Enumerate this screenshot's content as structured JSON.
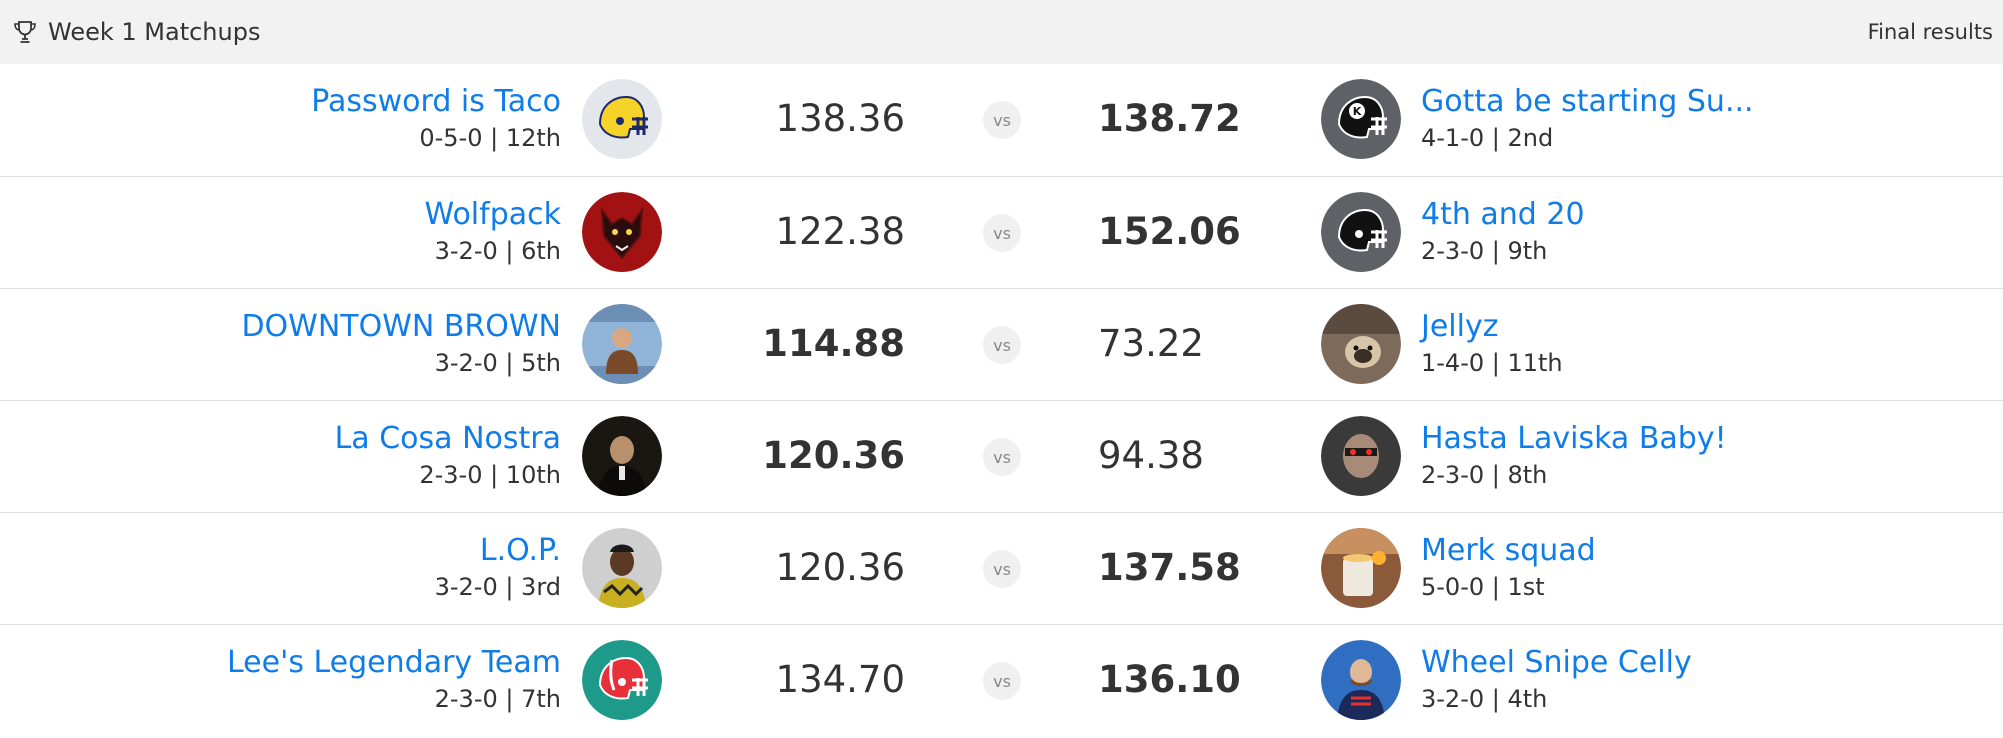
{
  "header": {
    "title": "Week 1 Matchups",
    "status": "Final results"
  },
  "matchups": [
    {
      "left": {
        "name": "Password is Taco",
        "record": "0-5-0 | 12th",
        "score": "138.36",
        "avatar": "yellow-helmet"
      },
      "right": {
        "name": "Gotta be starting Su...",
        "record": "4-1-0 | 2nd",
        "score": "138.72",
        "avatar": "k-helmet"
      },
      "winner": "right"
    },
    {
      "left": {
        "name": "Wolfpack",
        "record": "3-2-0 | 6th",
        "score": "122.38",
        "avatar": "wolf"
      },
      "right": {
        "name": "4th and 20",
        "record": "2-3-0 | 9th",
        "score": "152.06",
        "avatar": "black-helmet"
      },
      "winner": "right"
    },
    {
      "left": {
        "name": "DOWNTOWN BROWN",
        "record": "3-2-0 | 5th",
        "score": "114.88",
        "avatar": "meme-photo"
      },
      "right": {
        "name": "Jellyz",
        "record": "1-4-0 | 11th",
        "score": "73.22",
        "avatar": "pug-photo"
      },
      "winner": "left"
    },
    {
      "left": {
        "name": "La Cosa Nostra",
        "record": "2-3-0 | 10th",
        "score": "120.36",
        "avatar": "godfather-photo"
      },
      "right": {
        "name": "Hasta Laviska Baby!",
        "record": "2-3-0 | 8th",
        "score": "94.38",
        "avatar": "terminator-photo"
      },
      "winner": "left"
    },
    {
      "left": {
        "name": "L.O.P.",
        "record": "3-2-0 | 3rd",
        "score": "120.36",
        "avatar": "player-photo"
      },
      "right": {
        "name": "Merk squad",
        "record": "5-0-0 | 1st",
        "score": "137.58",
        "avatar": "candle-photo"
      },
      "winner": "right"
    },
    {
      "left": {
        "name": "Lee's Legendary Team",
        "record": "2-3-0 | 7th",
        "score": "134.70",
        "avatar": "teal-helmet"
      },
      "right": {
        "name": "Wheel Snipe Celly",
        "record": "3-2-0 | 4th",
        "score": "136.10",
        "avatar": "coach-photo"
      },
      "winner": "right"
    }
  ],
  "vs_label": "vs",
  "colors": {
    "link": "#0f7ce8",
    "header_bg": "#f2f2f2"
  }
}
